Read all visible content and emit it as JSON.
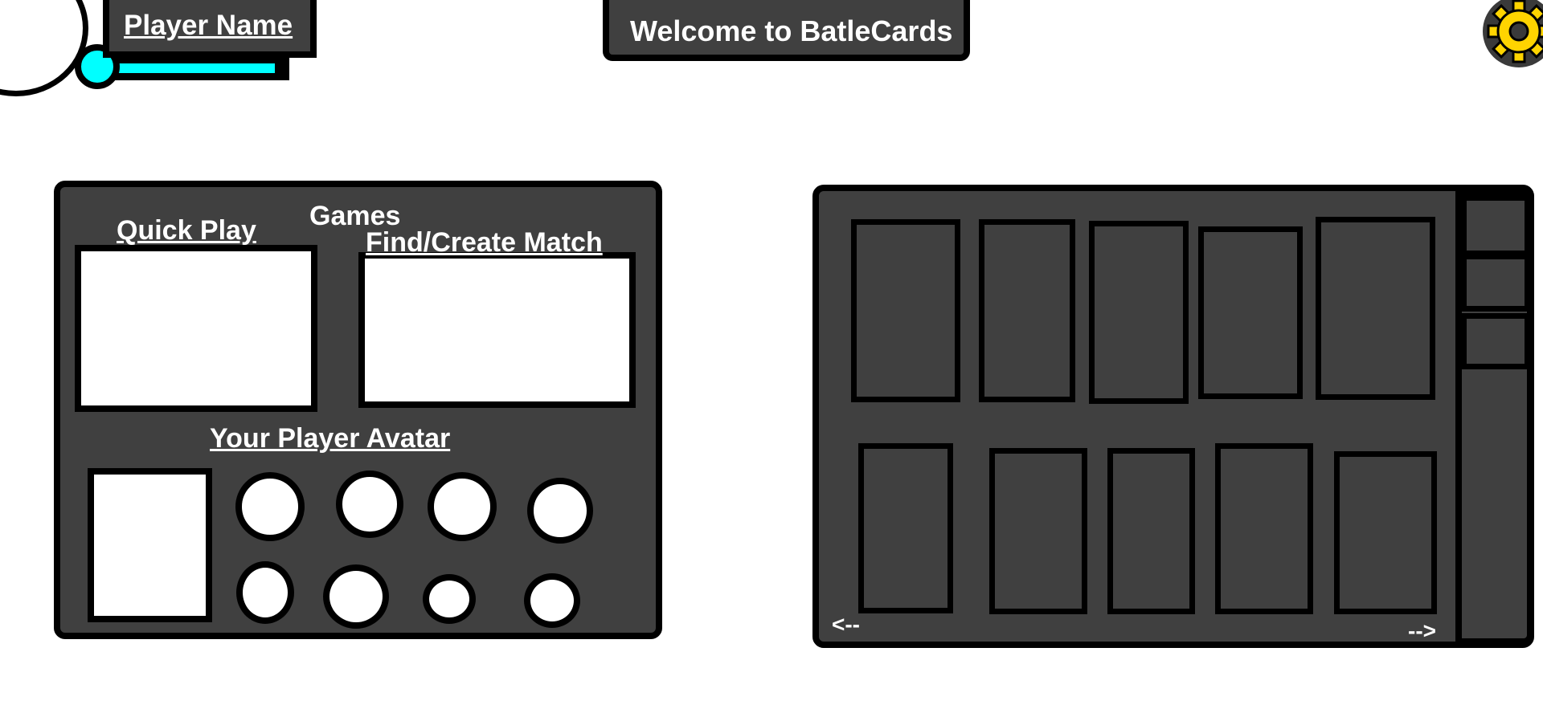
{
  "header": {
    "player_name": "Player Name",
    "xp_progress": 0.95,
    "welcome": "Welcome to BatleCards",
    "settings_icon": "gear-icon",
    "accent_color": "#00ffff",
    "gear_color": "#ffd400"
  },
  "games": {
    "title": "Games",
    "quick_play_label": "Quick Play",
    "find_create_label": "Find/Create Match",
    "avatar_label": "Your Player Avatar"
  },
  "cards": {
    "prev_label": "<--",
    "next_label": "-->"
  }
}
